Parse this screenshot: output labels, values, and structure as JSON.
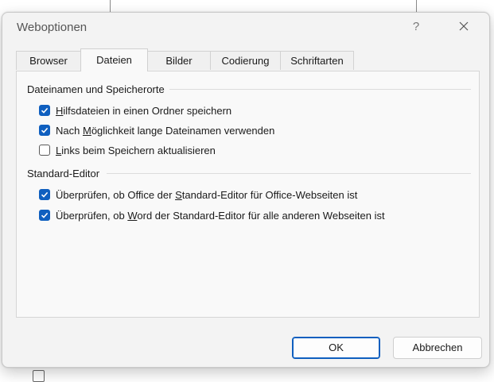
{
  "window": {
    "title": "Weboptionen",
    "help_label": "?",
    "close_icon": "close-icon"
  },
  "tabs": [
    {
      "label": "Browser",
      "active": false
    },
    {
      "label": "Dateien",
      "active": true
    },
    {
      "label": "Bilder",
      "active": false
    },
    {
      "label": "Codierung",
      "active": false
    },
    {
      "label": "Schriftarten",
      "active": false
    }
  ],
  "groups": {
    "filenames": {
      "title": "Dateinamen und Speicherorte",
      "options": [
        {
          "acc": "H",
          "rest": "ilfsdateien in einen Ordner speichern",
          "checked": true
        },
        {
          "pre": "Nach ",
          "acc": "M",
          "rest": "öglichkeit lange Dateinamen verwenden",
          "checked": true
        },
        {
          "acc": "L",
          "rest": "inks beim Speichern aktualisieren",
          "checked": false
        }
      ]
    },
    "editor": {
      "title": "Standard-Editor",
      "options": [
        {
          "pre": "Überprüfen, ob Office der ",
          "acc": "S",
          "rest": "tandard-Editor für Office-Webseiten ist",
          "checked": true
        },
        {
          "pre": "Überprüfen, ob ",
          "acc": "W",
          "rest": "ord der Standard-Editor für alle anderen Webseiten ist",
          "checked": true
        }
      ]
    }
  },
  "buttons": {
    "ok": "OK",
    "cancel": "Abbrechen"
  },
  "colors": {
    "accent": "#0f5fbf"
  }
}
